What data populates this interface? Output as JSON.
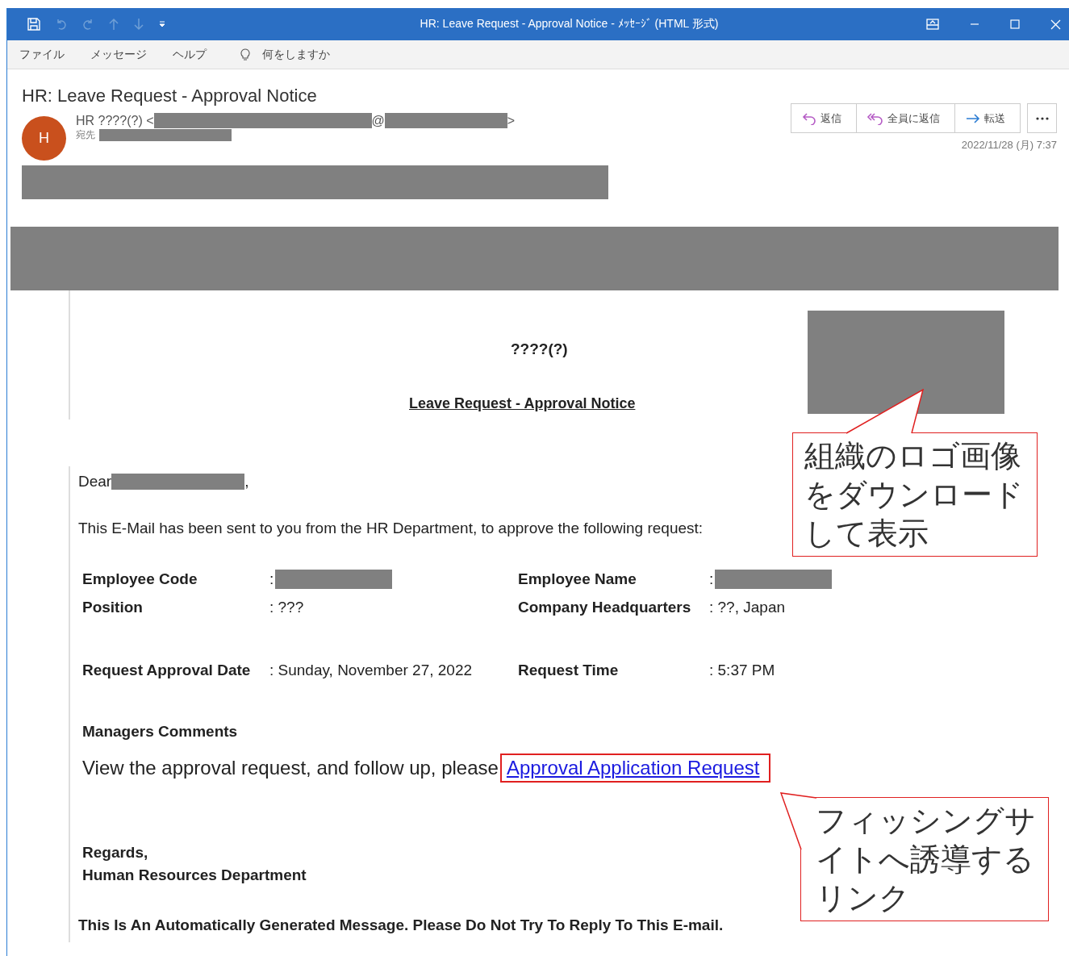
{
  "window": {
    "title": "HR: Leave Request - Approval Notice  -  ﾒｯｾｰｼﾞ (HTML 形式)"
  },
  "menu": [
    {
      "label": "ファイル"
    },
    {
      "label": "メッセージ"
    },
    {
      "label": "ヘルプ"
    }
  ],
  "search": {
    "placeholder": "何をしますか"
  },
  "message": {
    "subject": "HR: Leave Request - Approval Notice",
    "avatar": "H",
    "sender": {
      "name": "HR ????(?) <",
      "at": "@",
      "close": ">"
    },
    "to_label": "宛先",
    "actions": [
      {
        "label": "返信",
        "kind": "reply"
      },
      {
        "label": "全員に返信",
        "kind": "reply_all"
      },
      {
        "label": "転送",
        "kind": "forward"
      }
    ],
    "date": "2022/11/28 (月) 7:37"
  },
  "body": {
    "heading": "????(?)",
    "subheading": "Leave Request - Approval Notice",
    "greeting": {
      "text": "Dear",
      "after": ","
    },
    "intro": "This E-Mail has been sent to you from the HR Department, to approve the following request:",
    "detail_groups": [
      [
        {
          "label": "Employee Code",
          "value": ":",
          "redacted": true
        },
        {
          "label": "Employee Name",
          "value": ":",
          "redacted": true
        },
        {
          "label": "Position",
          "value": ": ???",
          "redacted": false
        },
        {
          "label": "Company Headquarters",
          "value": ": ??, Japan",
          "redacted": false
        }
      ],
      [
        {
          "label": "Request Approval Date",
          "value": ": Sunday, November 27, 2022",
          "redacted": false
        },
        {
          "label": "Request Time",
          "value": ": 5:37 PM",
          "redacted": false
        }
      ]
    ],
    "comments_heading": "Managers Comments",
    "comment": "View the approval request, and follow up, please",
    "link": "Approval Application Request",
    "regards": "Regards,",
    "department": "Human Resources Department",
    "footer": "This Is An Automatically Generated Message. Please Do Not Try To Reply To This E-mail."
  },
  "callouts": [
    {
      "text": "組織のロゴ画像をダウンロードして表示",
      "kind": "logo"
    },
    {
      "text": "フィッシングサイトへ誘導するリンク",
      "kind": "link"
    }
  ]
}
